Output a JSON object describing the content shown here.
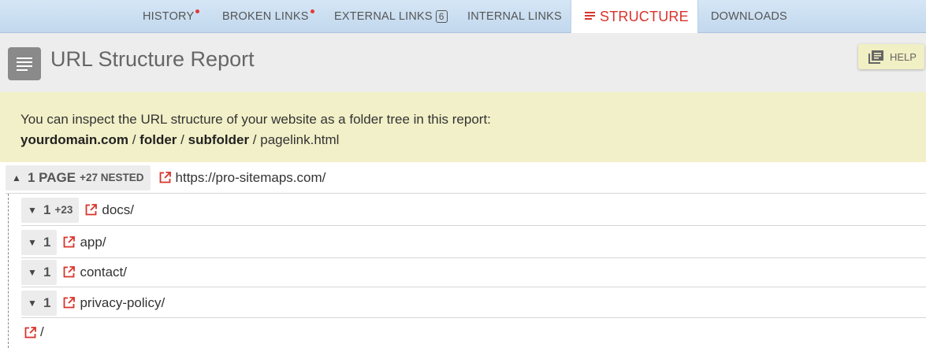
{
  "tabs": {
    "history": "HISTORY",
    "broken_links": "BROKEN LINKS",
    "external_links": "EXTERNAL LINKS",
    "external_links_count": "6",
    "internal_links": "INTERNAL LINKS",
    "structure": "STRUCTURE",
    "downloads": "DOWNLOADS"
  },
  "header": {
    "title": "URL Structure Report",
    "help_label": "HELP"
  },
  "info": {
    "line1": "You can inspect the URL structure of your website as a folder tree in this report:",
    "domain": "yourdomain.com",
    "sep": "/",
    "folder": "folder",
    "subfolder": "subfolder",
    "page": "pagelink.html"
  },
  "tree": {
    "root": {
      "count": "1 PAGE",
      "nested": "+27 NESTED",
      "url": "https://pro-sitemaps.com/"
    },
    "items": [
      {
        "count": "1",
        "nested": "+23",
        "path": "docs/"
      },
      {
        "count": "1",
        "path": "app/"
      },
      {
        "count": "1",
        "path": "contact/"
      },
      {
        "count": "1",
        "path": "privacy-policy/"
      }
    ],
    "leaf": {
      "path": "/"
    }
  },
  "colors": {
    "accent": "#d9332b",
    "tab_bg": "#c8dcf0",
    "info_bg": "#f2f0c8"
  },
  "icons": {
    "external": "external-link-icon",
    "chevron_up": "chevron-up-icon",
    "chevron_down": "chevron-down-icon"
  }
}
